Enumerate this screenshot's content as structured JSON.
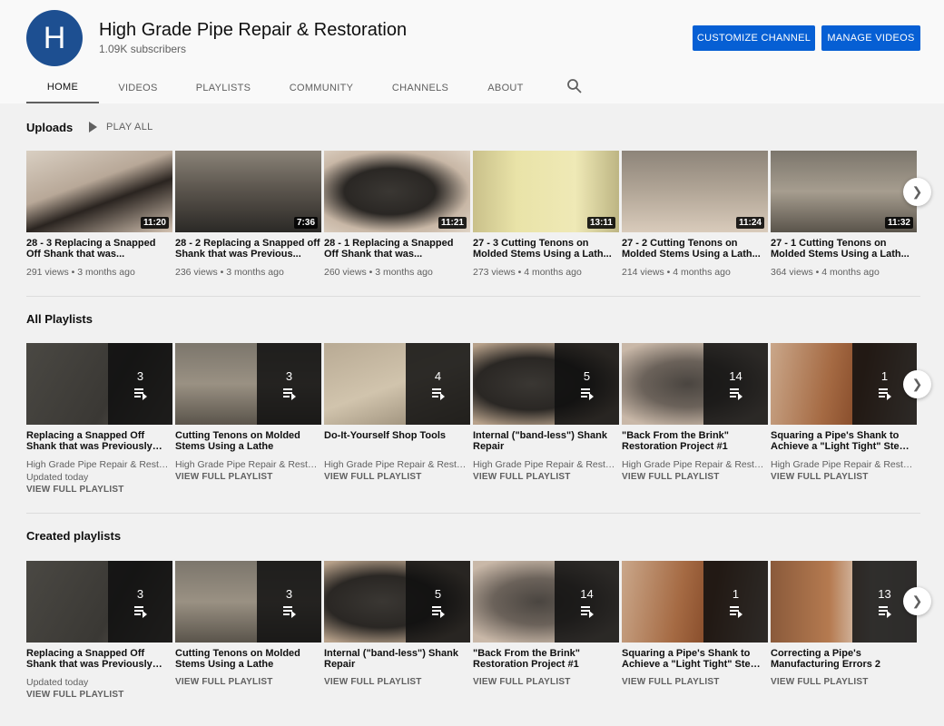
{
  "channel": {
    "avatar_letter": "H",
    "name": "High Grade Pipe Repair & Restoration",
    "subscribers": "1.09K subscribers",
    "customize_label": "CUSTOMIZE CHANNEL",
    "manage_label": "MANAGE VIDEOS"
  },
  "tabs": [
    "HOME",
    "VIDEOS",
    "PLAYLISTS",
    "COMMUNITY",
    "CHANNELS",
    "ABOUT"
  ],
  "uploads": {
    "title": "Uploads",
    "play_all": "PLAY ALL",
    "videos": [
      {
        "title": "28 - 3 Replacing a Snapped Off Shank that was...",
        "duration": "11:20",
        "meta": "291 views • 3 months ago"
      },
      {
        "title": "28 - 2 Replacing a Snapped off Shank that was Previous...",
        "duration": "7:36",
        "meta": "236 views • 3 months ago"
      },
      {
        "title": "28 - 1 Replacing a Snapped Off Shank that was...",
        "duration": "11:21",
        "meta": "260 views • 3 months ago"
      },
      {
        "title": "27 - 3 Cutting Tenons on Molded Stems Using a Lath...",
        "duration": "13:11",
        "meta": "273 views • 4 months ago"
      },
      {
        "title": "27 - 2 Cutting Tenons on Molded Stems Using a Lath...",
        "duration": "11:24",
        "meta": "214 views • 4 months ago"
      },
      {
        "title": "27 - 1 Cutting Tenons on Molded Stems Using a Lath...",
        "duration": "11:32",
        "meta": "364 views • 4 months ago"
      }
    ]
  },
  "all_playlists": {
    "title": "All Playlists",
    "items": [
      {
        "title": "Replacing a Snapped Off Shank that was Previously Glued",
        "count": "3",
        "owner": "High Grade Pipe Repair & Restoration",
        "updated": "Updated today",
        "link": "VIEW FULL PLAYLIST"
      },
      {
        "title": "Cutting Tenons on Molded Stems Using a Lathe",
        "count": "3",
        "owner": "High Grade Pipe Repair & Restoration",
        "updated": "",
        "link": "VIEW FULL PLAYLIST"
      },
      {
        "title": "Do-It-Yourself Shop Tools",
        "count": "4",
        "owner": "High Grade Pipe Repair & Restoration",
        "updated": "",
        "link": "VIEW FULL PLAYLIST"
      },
      {
        "title": "Internal (\"band-less\") Shank Repair",
        "count": "5",
        "owner": "High Grade Pipe Repair & Restoration",
        "updated": "",
        "link": "VIEW FULL PLAYLIST"
      },
      {
        "title": "\"Back From the Brink\" Restoration Project #1",
        "count": "14",
        "owner": "High Grade Pipe Repair & Restoration",
        "updated": "",
        "link": "VIEW FULL PLAYLIST"
      },
      {
        "title": "Squaring a Pipe's Shank to Achieve a \"Light Tight\" Stem Fit",
        "count": "1",
        "owner": "High Grade Pipe Repair & Restoration",
        "updated": "",
        "link": "VIEW FULL PLAYLIST"
      }
    ]
  },
  "created_playlists": {
    "title": "Created playlists",
    "items": [
      {
        "title": "Replacing a Snapped Off Shank that was Previously Glued",
        "count": "3",
        "updated": "Updated today",
        "link": "VIEW FULL PLAYLIST"
      },
      {
        "title": "Cutting Tenons on Molded Stems Using a Lathe",
        "count": "3",
        "updated": "",
        "link": "VIEW FULL PLAYLIST"
      },
      {
        "title": "Internal (\"band-less\") Shank Repair",
        "count": "5",
        "updated": "",
        "link": "VIEW FULL PLAYLIST"
      },
      {
        "title": "\"Back From the Brink\" Restoration Project #1",
        "count": "14",
        "updated": "",
        "link": "VIEW FULL PLAYLIST"
      },
      {
        "title": "Squaring a Pipe's Shank to Achieve a \"Light Tight\" Stem Fit",
        "count": "1",
        "updated": "",
        "link": "VIEW FULL PLAYLIST"
      },
      {
        "title": "Correcting a Pipe's Manufacturing Errors 2",
        "count": "13",
        "updated": "",
        "link": "VIEW FULL PLAYLIST"
      }
    ]
  },
  "icons": {
    "search": "search-icon",
    "next": "chevron-right-icon",
    "play": "play-icon",
    "playlist": "playlist-icon"
  },
  "colors": {
    "accent": "#065fd4",
    "avatar": "#1d4f91"
  }
}
